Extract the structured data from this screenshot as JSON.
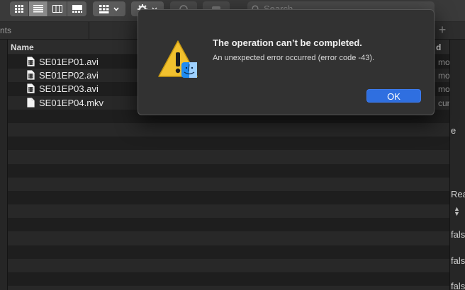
{
  "toolbar": {
    "view_modes": [
      "icon-view",
      "list-view",
      "column-view",
      "gallery-view"
    ],
    "active_view": "list-view",
    "search_placeholder": "Search"
  },
  "tabbar": {
    "left_label": "nts",
    "add_tab": "+"
  },
  "list": {
    "columns": {
      "name": "Name",
      "kind": "d"
    },
    "files": [
      {
        "name": "SE01EP01.avi",
        "kind": "mo",
        "icon": "video-file-icon"
      },
      {
        "name": "SE01EP02.avi",
        "kind": "mo",
        "icon": "video-file-icon"
      },
      {
        "name": "SE01EP03.avi",
        "kind": "mo",
        "icon": "video-file-icon"
      },
      {
        "name": "SE01EP04.mkv",
        "kind": "cum",
        "icon": "document-file-icon"
      }
    ]
  },
  "right_panel": {
    "text_1": "e",
    "text_2": "Rea",
    "text_3": "fals",
    "text_4": "fals",
    "text_5": "fals"
  },
  "dialog": {
    "title": "The operation can’t be completed.",
    "message": "An unexpected error occurred (error code -43).",
    "ok_label": "OK",
    "icon": "warning-finder-icon"
  },
  "colors": {
    "accent": "#2f6fe0",
    "warning": "#f2c12e"
  }
}
